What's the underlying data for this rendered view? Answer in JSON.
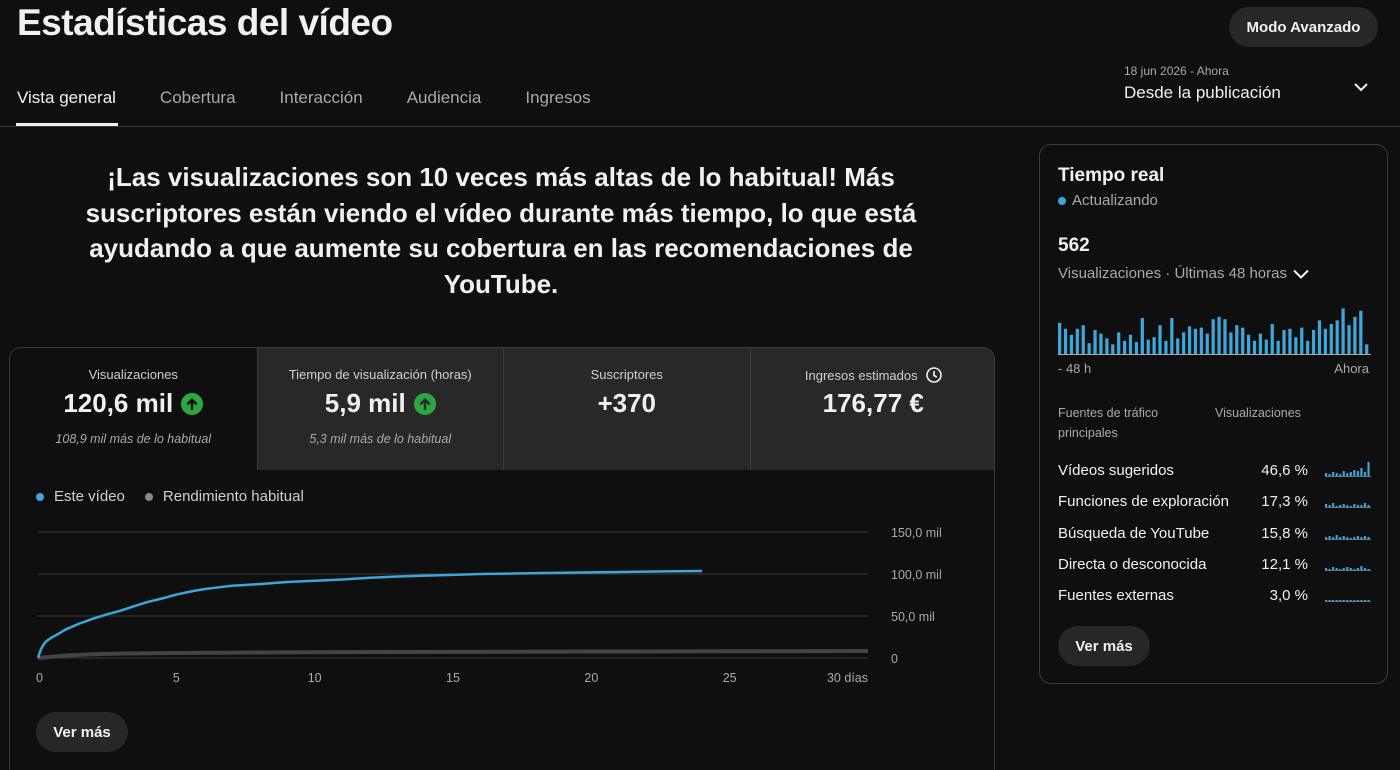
{
  "header": {
    "title": "Estadísticas del vídeo",
    "advanced_button": "Modo Avanzado",
    "date_range": {
      "top": "18 jun 2026 - Ahora",
      "main": "Desde la publicación"
    }
  },
  "tabs": [
    {
      "label": "Vista general",
      "active": true
    },
    {
      "label": "Cobertura",
      "active": false
    },
    {
      "label": "Interacción",
      "active": false
    },
    {
      "label": "Audiencia",
      "active": false
    },
    {
      "label": "Ingresos",
      "active": false
    }
  ],
  "headline": "¡Las visualizaciones son 10 veces más altas de lo habitual! Más suscriptores están viendo el vídeo durante más tiempo, lo que está ayudando a que aumente su cobertura en las recomendaciones de YouTube.",
  "metrics": [
    {
      "label": "Visualizaciones",
      "value": "120,6 mil",
      "up": true,
      "sub": "108,9 mil más de lo habitual"
    },
    {
      "label": "Tiempo de visualización (horas)",
      "value": "5,9 mil",
      "up": true,
      "sub": "5,3 mil más de lo habitual"
    },
    {
      "label": "Suscriptores",
      "value": "+370",
      "up": false,
      "sub": ""
    },
    {
      "label": "Ingresos estimados",
      "value": "176,77 €",
      "up": false,
      "sub": "",
      "icon": "clock-icon"
    }
  ],
  "legend": {
    "this_video": "Este vídeo",
    "typical": "Rendimiento habitual"
  },
  "colors": {
    "accent": "#3ea6d8",
    "up": "#2ba640",
    "typical": "#aaaaaa"
  },
  "chart_data": {
    "type": "line",
    "x_ticks": [
      "0",
      "5",
      "10",
      "15",
      "20",
      "25",
      "30 días"
    ],
    "y_ticks": [
      "0",
      "50,0 mil",
      "100,0 mil",
      "150,0 mil"
    ],
    "ylim": [
      0,
      150000
    ],
    "xlim": [
      0,
      30
    ],
    "series": [
      {
        "name": "Este vídeo",
        "x": [
          0,
          0.05,
          0.1,
          0.2,
          0.3,
          0.5,
          0.75,
          1,
          1.5,
          2,
          2.5,
          3,
          3.5,
          4,
          4.5,
          5,
          5.5,
          6,
          6.5,
          7,
          8,
          9,
          10,
          11,
          12,
          13,
          14,
          15,
          16,
          17,
          18,
          19,
          20,
          21,
          22,
          23,
          24
        ],
        "y": [
          0,
          5000,
          10000,
          16000,
          20000,
          24500,
          29000,
          34000,
          41000,
          47000,
          52000,
          56500,
          62000,
          67000,
          71000,
          75500,
          79000,
          82000,
          84000,
          86000,
          88000,
          90500,
          92000,
          93500,
          95500,
          97000,
          98000,
          99000,
          100000,
          100500,
          101000,
          101500,
          102000,
          102400,
          102800,
          103200,
          103600
        ]
      },
      {
        "name": "Rendimiento habitual",
        "x": [
          0,
          1,
          2,
          3,
          5,
          8,
          10,
          15,
          20,
          25,
          30
        ],
        "y": [
          0,
          3000,
          4500,
          5300,
          6000,
          6600,
          6900,
          7300,
          7700,
          8000,
          8300
        ]
      }
    ]
  },
  "ver_mas": "Ver más",
  "realtime": {
    "title": "Tiempo real",
    "status": "Actualizando",
    "count": "562",
    "period": "Visualizaciones · Últimas 48 horas",
    "axis_left": "- 48 h",
    "axis_right": "Ahora",
    "bars": [
      26,
      21,
      16,
      21,
      24,
      9,
      20,
      17,
      13,
      8,
      18,
      11,
      16,
      10,
      30,
      12,
      14,
      24,
      11,
      30,
      13,
      18,
      23,
      21,
      22,
      17,
      29,
      31,
      29,
      18,
      24,
      22,
      16,
      11,
      17,
      12,
      25,
      11,
      20,
      21,
      14,
      22,
      11,
      20,
      28,
      21,
      25,
      28,
      38,
      24,
      31,
      36,
      8
    ],
    "header_left": "Fuentes de tráfico principales",
    "header_right": "Visualizaciones",
    "sources": [
      {
        "name": "Vídeos sugeridos",
        "pct": "46,6 %"
      },
      {
        "name": "Funciones de exploración",
        "pct": "17,3 %"
      },
      {
        "name": "Búsqueda de YouTube",
        "pct": "15,8 %"
      },
      {
        "name": "Directa o desconocida",
        "pct": "12,1 %"
      },
      {
        "name": "Fuentes externas",
        "pct": "3,0 %"
      }
    ]
  }
}
